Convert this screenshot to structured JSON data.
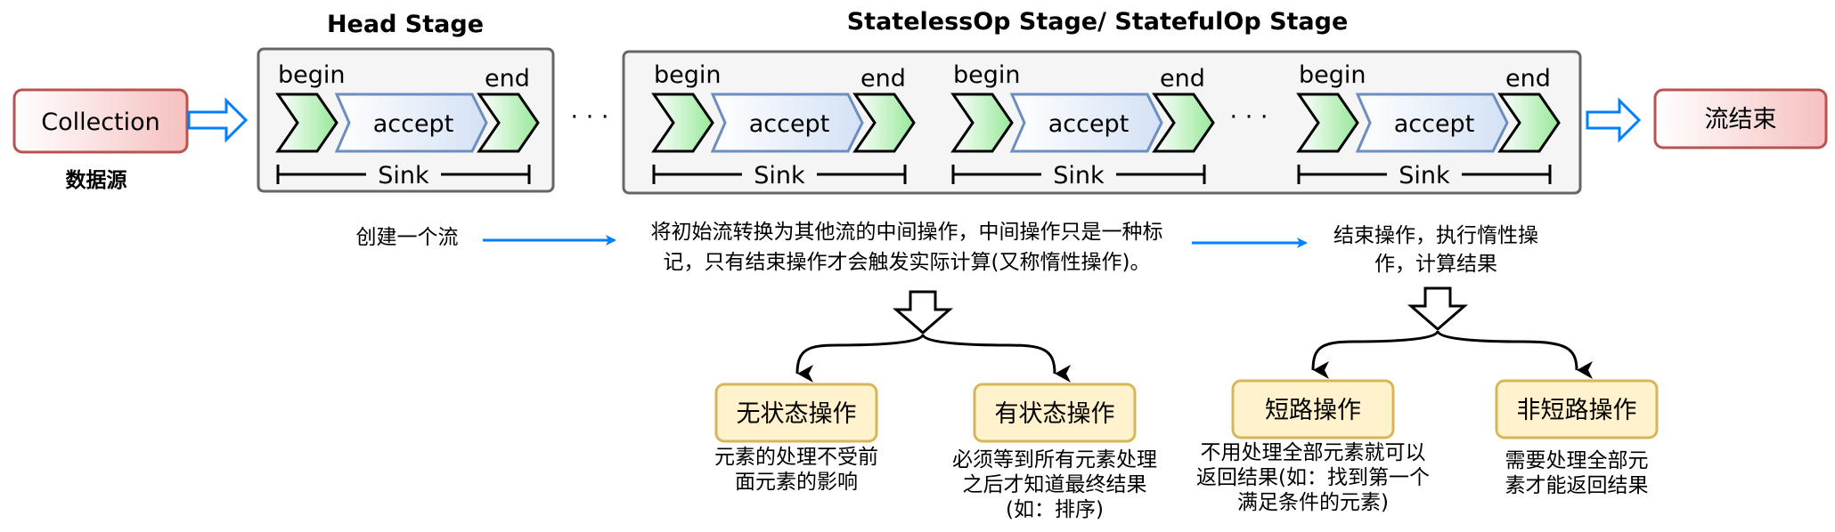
{
  "titles": {
    "head_stage": "Head Stage",
    "op_stage": "StatelessOp Stage/ StatefulOp Stage"
  },
  "source": {
    "label": "Collection",
    "caption": "数据源"
  },
  "sink_unit": {
    "begin": "begin",
    "accept": "accept",
    "end": "end",
    "sink": "Sink"
  },
  "ellipsis": "· · ·",
  "terminal": {
    "label": "流结束"
  },
  "descriptions": {
    "head": "创建一个流",
    "intermediate_lines": [
      "将初始流转换为其他流的中间操作，中间操作只是一种标",
      "记，只有结束操作才会触发实际计算(又称惰性操作)。"
    ],
    "terminal_lines": [
      "结束操作，执行惰性操",
      "作，计算结果"
    ]
  },
  "categories": [
    {
      "label": "无状态操作",
      "desc_lines": [
        "元素的处理不受前",
        "面元素的影响"
      ]
    },
    {
      "label": "有状态操作",
      "desc_lines": [
        "必须等到所有元素处理",
        "之后才知道最终结果",
        "(如：排序)"
      ]
    },
    {
      "label": "短路操作",
      "desc_lines": [
        "不用处理全部元素就可以",
        "返回结果(如：找到第一个",
        "满足条件的元素)"
      ]
    },
    {
      "label": "非短路操作",
      "desc_lines": [
        "需要处理全部元",
        "素才能返回结果"
      ]
    }
  ],
  "colors": {
    "stage_fill": "#f5f5f5",
    "stage_stroke": "#666666",
    "source_fill": "#f8cecc",
    "source_stroke": "#b85450",
    "chevron_fill": "#d5e8d4",
    "chevron_stroke": "#000000",
    "accept_fill": "#dae8fc",
    "accept_stroke": "#6c8ebf",
    "arrow_blue": "#007fff",
    "category_fill": "#fff2cc",
    "category_stroke": "#d6b656"
  }
}
